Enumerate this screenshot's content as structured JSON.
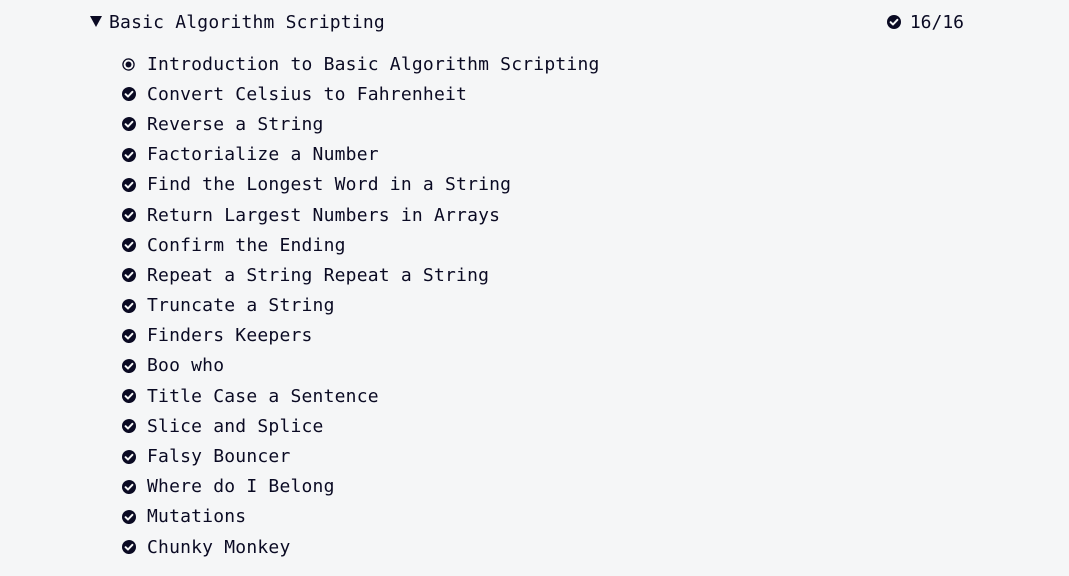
{
  "block": {
    "title": "Basic Algorithm Scripting",
    "progress": "16/16",
    "expanded": true,
    "caret_icon": "caret-down-icon",
    "complete_icon": "check-circle-icon"
  },
  "challenges": [
    {
      "label": "Introduction to Basic Algorithm Scripting",
      "icon": "radio-dot-icon"
    },
    {
      "label": "Convert Celsius to Fahrenheit",
      "icon": "check-circle-icon"
    },
    {
      "label": "Reverse a String",
      "icon": "check-circle-icon"
    },
    {
      "label": "Factorialize a Number",
      "icon": "check-circle-icon"
    },
    {
      "label": "Find the Longest Word in a String",
      "icon": "check-circle-icon"
    },
    {
      "label": "Return Largest Numbers in Arrays",
      "icon": "check-circle-icon"
    },
    {
      "label": "Confirm the Ending",
      "icon": "check-circle-icon"
    },
    {
      "label": "Repeat a String Repeat a String",
      "icon": "check-circle-icon"
    },
    {
      "label": "Truncate a String",
      "icon": "check-circle-icon"
    },
    {
      "label": "Finders Keepers",
      "icon": "check-circle-icon"
    },
    {
      "label": "Boo who",
      "icon": "check-circle-icon"
    },
    {
      "label": "Title Case a Sentence",
      "icon": "check-circle-icon"
    },
    {
      "label": "Slice and Splice",
      "icon": "check-circle-icon"
    },
    {
      "label": "Falsy Bouncer",
      "icon": "check-circle-icon"
    },
    {
      "label": "Where do I Belong",
      "icon": "check-circle-icon"
    },
    {
      "label": "Mutations",
      "icon": "check-circle-icon"
    },
    {
      "label": "Chunky Monkey",
      "icon": "check-circle-icon"
    }
  ],
  "colors": {
    "background": "#f5f6f7",
    "text": "#0a0a23"
  }
}
